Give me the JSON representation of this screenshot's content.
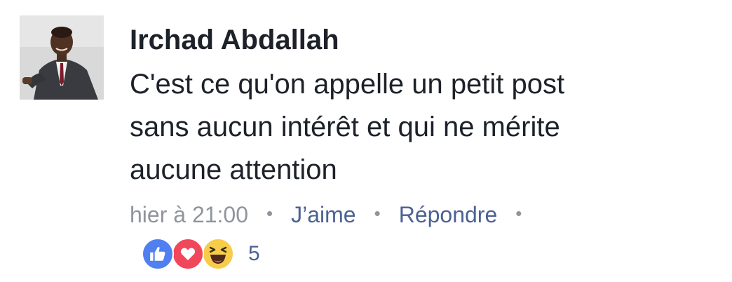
{
  "comment": {
    "author": "Irchad Abdallah",
    "body_lines": [
      "C'est ce qu'on appelle un petit post",
      "sans aucun intérêt et qui ne mérite",
      "aucune attention"
    ],
    "timestamp": "hier à 21:00",
    "separator": "•",
    "actions": {
      "like_label": "J’aime",
      "reply_label": "Répondre"
    },
    "reactions": {
      "icons": [
        "like-icon",
        "love-icon",
        "haha-icon"
      ],
      "count": "5"
    }
  },
  "colors": {
    "author_text": "#1d2129",
    "meta_text": "#90949c",
    "action_link": "#4b6293",
    "like": "#4f7ff0",
    "love": "#f0475a",
    "haha": "#f7cc4a"
  }
}
